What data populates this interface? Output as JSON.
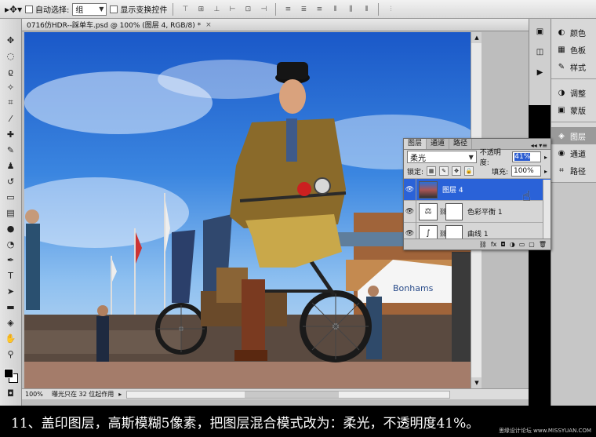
{
  "options_bar": {
    "move_icon": "move-tool-icon",
    "auto_select_label": "自动选择:",
    "auto_select_value": "组",
    "show_transform_label": "显示变换控件"
  },
  "document": {
    "title": "0716仿HDR--踩单车.psd @ 100% (图层 4, RGB/8) *",
    "close_glyph": "×",
    "zoom": "100%",
    "status_text": "曝光只在 32 位起作用",
    "scroll_up": "▲",
    "scroll_down": "▼"
  },
  "photo": {
    "tent_text": "Bonhams"
  },
  "dock": {
    "items": [
      {
        "label": "颜色",
        "icon": "color-icon",
        "glyph": "◐"
      },
      {
        "label": "色板",
        "icon": "swatches-icon",
        "glyph": "▦"
      },
      {
        "label": "样式",
        "icon": "styles-icon",
        "glyph": "✎"
      },
      {
        "label": "调整",
        "icon": "adjustments-icon",
        "glyph": "◑"
      },
      {
        "label": "蒙版",
        "icon": "masks-icon",
        "glyph": "▣"
      },
      {
        "label": "图层",
        "icon": "layers-icon",
        "glyph": "◈"
      },
      {
        "label": "通道",
        "icon": "channels-icon",
        "glyph": "◉"
      },
      {
        "label": "路径",
        "icon": "paths-icon",
        "glyph": "⌗"
      }
    ]
  },
  "layers_panel": {
    "tabs": [
      "图层",
      "通道",
      "路径"
    ],
    "blend_mode": "柔光",
    "opacity_label": "不透明度:",
    "opacity": "41%",
    "lock_label": "锁定:",
    "fill_label": "填充:",
    "fill": "100%",
    "menu_glyph": "◂◂ ▾≡",
    "layers": [
      {
        "name": "图层 4",
        "selected": true
      },
      {
        "name": "色彩平衡 1",
        "selected": false
      },
      {
        "name": "曲线 1",
        "selected": false
      }
    ]
  },
  "caption": {
    "text": "11、盖印图层，高斯模糊5像素，把图层混合模式改为：柔光，不透明度41%。",
    "watermark": "思缘设计论坛 www.MISSYUAN.COM"
  },
  "colors": {
    "accent": "#2a62d8",
    "sky_top": "#1a58c8",
    "caption_bg": "#000000"
  }
}
